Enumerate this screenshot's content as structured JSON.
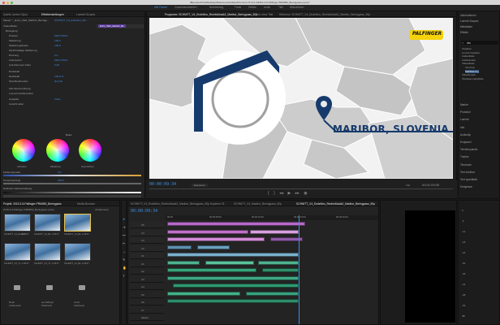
{
  "window": {
    "title": "/Benutzer/chna/Desktop/Dokumente/Adobe/Premiere Pro/14.0/2019-2-6 Palfinger PRM050_Beringpass.prproj *"
  },
  "workspaces": [
    "Alle Panels",
    "Zusammenarbeiten",
    "Bearbeitung",
    "Farbe",
    "Effekte",
    "Audio",
    "Titel",
    "Bibliotheken"
  ],
  "colors": {
    "accent": "#3d8fe3",
    "timecode": "#3d8fe3",
    "brand_yellow": "#f4d20c",
    "map_blue": "#163a6b"
  },
  "effect_controls": {
    "tabs": [
      "Quelle: (keine Clips)",
      "Effekteinstellungen",
      "Lumetri-Scopes"
    ],
    "source_label": "Master * _Extro_Tail1_Maribor_Beringp...",
    "sequence_label": "SCHNITT_V4_EndeNeu_Bo...",
    "clip_label": "Extro_Tail1_Maribor_Be",
    "sections": [
      "Videoeffekte",
      "Bewegung"
    ],
    "rows": [
      {
        "label": "Position",
        "value": "960,0   540,0"
      },
      {
        "label": "Skalierung",
        "value": "100,0"
      },
      {
        "label": "Skalierungsbreite",
        "value": "100,0"
      },
      {
        "label": "Gleichmäßige Skalierung",
        "value": ""
      },
      {
        "label": "Drehung",
        "value": "0,0"
      },
      {
        "label": "Ankerpunkt",
        "value": "960,0   540,0"
      },
      {
        "label": "Anti-Flimmern-Filter",
        "value": "0,00"
      },
      {
        "label": "Deckkraft",
        "value": ""
      },
      {
        "label": "Deckkraft",
        "value": "100,0 %"
      },
      {
        "label": "Überblendmodus",
        "value": "Normal"
      },
      {
        "label": "Zeit-Neuzuordnung",
        "value": ""
      },
      {
        "label": "Lumetri-Farbkorrektur",
        "value": ""
      },
      {
        "label": "Ausgabe",
        "value": "Video"
      },
      {
        "label": "Ansicht teilen",
        "value": ""
      }
    ],
    "wheels_header": "Basis",
    "wheels": [
      "Schatten",
      "Mitteltöne",
      "Glanzlichter"
    ],
    "temp_label": "Farbtemperatur",
    "temp_value": "0,0",
    "hue_label": "Tonwertumfang",
    "hue_value": "255,0",
    "definition_label": "Definition Farbverwaltung"
  },
  "program_monitor": {
    "tabs": [
      "Alle Panels",
      "Zusammenarbeiten"
    ],
    "title": "Programm: SCHNITT_V4_EndeNeu_RechtsMusik2_Maribor_Beringpass_50p",
    "title2": "Text ohne Titel",
    "title3": "Referenz: SCHNITT_V4_EndeNeu_RechtsMusik2_Maribor_Beringpass_50p",
    "location": "MARIBOR, SLOVENIA",
    "brand": "PALFINGER",
    "timecode": "00:00:09:34",
    "fit": "Einpassen",
    "quality": "Voll",
    "duration": "00:01:09:05"
  },
  "right_panel": {
    "items": [
      "Informationen",
      "Lumetri-Scopes",
      "Metadaten",
      "Effekte"
    ],
    "search_placeholder": "dec",
    "tree": [
      "Vorgaben",
      "Lumetri-Vorgaben",
      "Audioeffekte",
      "Audioblenden",
      "Videoeffekte",
      "Verzerren",
      "Stabilisierung",
      "Videoblenden",
      "Überlagerungseffekte"
    ],
    "menu": [
      "Marker",
      "Protokoll",
      "Essential",
      "Essential",
      "Audio",
      "Endpanel",
      "Timelinepanels",
      "Ebene",
      "Fläche",
      "Text",
      "Ebenen",
      "Aktionen"
    ],
    "menu_labels": [
      "Marker",
      "Protokoll",
      "Lumetri",
      "Info",
      "Audioclip",
      "Endpanel",
      "Timelinepanels",
      "Tracker",
      "Timecode",
      "Text sichtbar",
      "Text quantitativ",
      "Ereignisse"
    ]
  },
  "project_panel": {
    "tabs": [
      "Projekt: 2019-2-6-Palfinger-PRM050_Beringpass",
      "Media-Browser",
      "Bibliothek"
    ],
    "path": "2019-2-6-Palfinger-PRM050_Beringpass.prproj",
    "count": "24 Elemente",
    "thumbs": [
      {
        "name": "SCHNITT_V4_EndeN...",
        "dur": "1:05:07"
      },
      {
        "name": "SCHNITT_V4_Be...",
        "dur": "1:05:07"
      },
      {
        "name": "SCHNITT_V4_Be...",
        "dur": "1:05:07"
      },
      {
        "name": "SCHNITT_V4_TL...",
        "dur": "1:05:07"
      },
      {
        "name": "SCHNITT_V4_TL...",
        "dur": "1:05:07"
      },
      {
        "name": "SCHNITT_V4_Be...",
        "dur": "1:05:07"
      }
    ],
    "folders": [
      "Musik",
      "aus Palfinger",
      "Archiv"
    ],
    "folder_counts": [
      "14 Elemente",
      "8 Elemente",
      "6 Elemente"
    ]
  },
  "timeline": {
    "tabs": [
      "SCHNITT_V4_EndeNeu_RechtsMusik2_Maribor_Beringpass_50p Kopieren 01",
      "SCHNITT_V4_Maribor_Beringpass_50p",
      "SCHNITT_V4_EndeNeu_RechtsMusik2_Maribor_Beringpass_50p"
    ],
    "timecode": "00:00:09:34",
    "ruler": [
      "00:00",
      "00:00:05:00",
      "00:00:10:00",
      "00:00:15:00",
      "00:00:20:00",
      "00:00:25:00"
    ],
    "tracks": [
      "V5",
      "V4",
      "V3",
      "V2",
      "V1",
      "A1",
      "A2",
      "A3",
      "A4",
      "A5",
      "A6",
      "A7",
      "Master"
    ],
    "meter_scale": [
      "0",
      "-6",
      "-12",
      "-18",
      "-24",
      "-30",
      "-36",
      "-42",
      "-48",
      "-54",
      "dB"
    ]
  }
}
